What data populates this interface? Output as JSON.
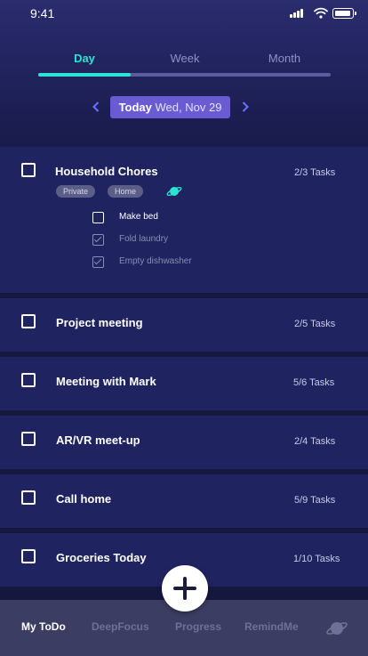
{
  "status": {
    "time": "9:41"
  },
  "tabs": [
    {
      "label": "Day",
      "active": true
    },
    {
      "label": "Week",
      "active": false
    },
    {
      "label": "Month",
      "active": false
    }
  ],
  "date": {
    "prefix": "Today",
    "value": "Wed, Nov 29"
  },
  "tasks": [
    {
      "title": "Household Chores",
      "count": "2/3 Tasks",
      "tags": [
        "Private",
        "Home"
      ],
      "subtasks": [
        {
          "label": "Make bed",
          "done": false
        },
        {
          "label": "Fold laundry",
          "done": true
        },
        {
          "label": "Empty dishwasher",
          "done": true
        }
      ]
    },
    {
      "title": "Project meeting",
      "count": "2/5 Tasks"
    },
    {
      "title": "Meeting with Mark",
      "count": "5/6 Tasks"
    },
    {
      "title": "AR/VR meet-up",
      "count": "2/4 Tasks"
    },
    {
      "title": "Call home",
      "count": "5/9 Tasks"
    },
    {
      "title": "Groceries Today",
      "count": "1/10 Tasks"
    }
  ],
  "nav": [
    {
      "label": "My ToDo",
      "active": true
    },
    {
      "label": "DeepFocus",
      "active": false
    },
    {
      "label": "Progress",
      "active": false
    },
    {
      "label": "RemindMe",
      "active": false
    }
  ],
  "colors": {
    "accent": "#2de3d3",
    "date_pill": "#6a5bd2",
    "card": "#1f2360",
    "nav_bg": "#3b3e62"
  }
}
